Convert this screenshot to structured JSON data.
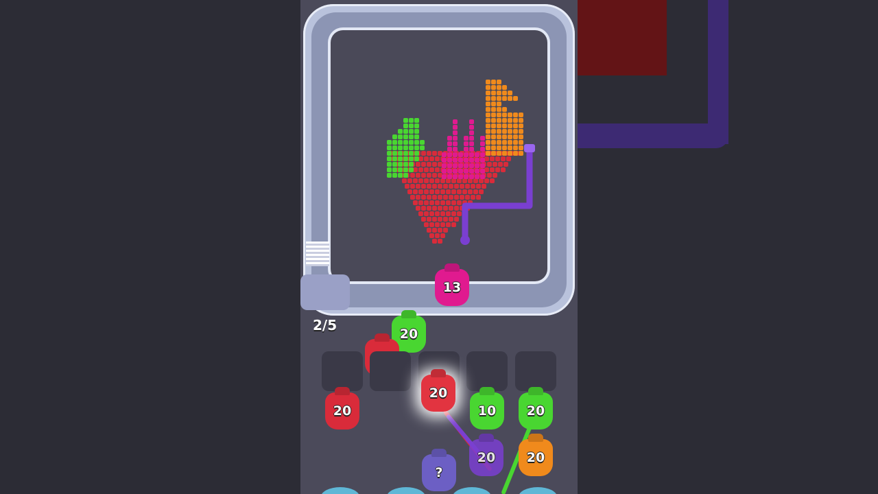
{
  "hud": {
    "level_progress": "2/5"
  },
  "conveyor": {
    "active_blob": {
      "count": "13",
      "color": "#e01a8f"
    }
  },
  "queue": [
    {
      "count": "20",
      "color": "#49d631"
    },
    {
      "count": "20",
      "color": "#d92b3a"
    }
  ],
  "grid": [
    {
      "count": "20",
      "color": "#d92b3a"
    },
    {
      "count": "20",
      "color": "#e23440"
    },
    {
      "count": "10",
      "color": "#49d631"
    },
    {
      "count": "20",
      "color": "#49d631"
    },
    {
      "count": "20",
      "color": "#7a3fd1"
    },
    {
      "count": "20",
      "color": "#f08a1c"
    },
    {
      "count": "?",
      "color": "#6c5fc4"
    }
  ],
  "colors": {
    "red": "#d92b3a",
    "green": "#49d631",
    "magenta": "#e01a8f",
    "orange": "#f08a1c",
    "purple": "#7a3fd1"
  }
}
